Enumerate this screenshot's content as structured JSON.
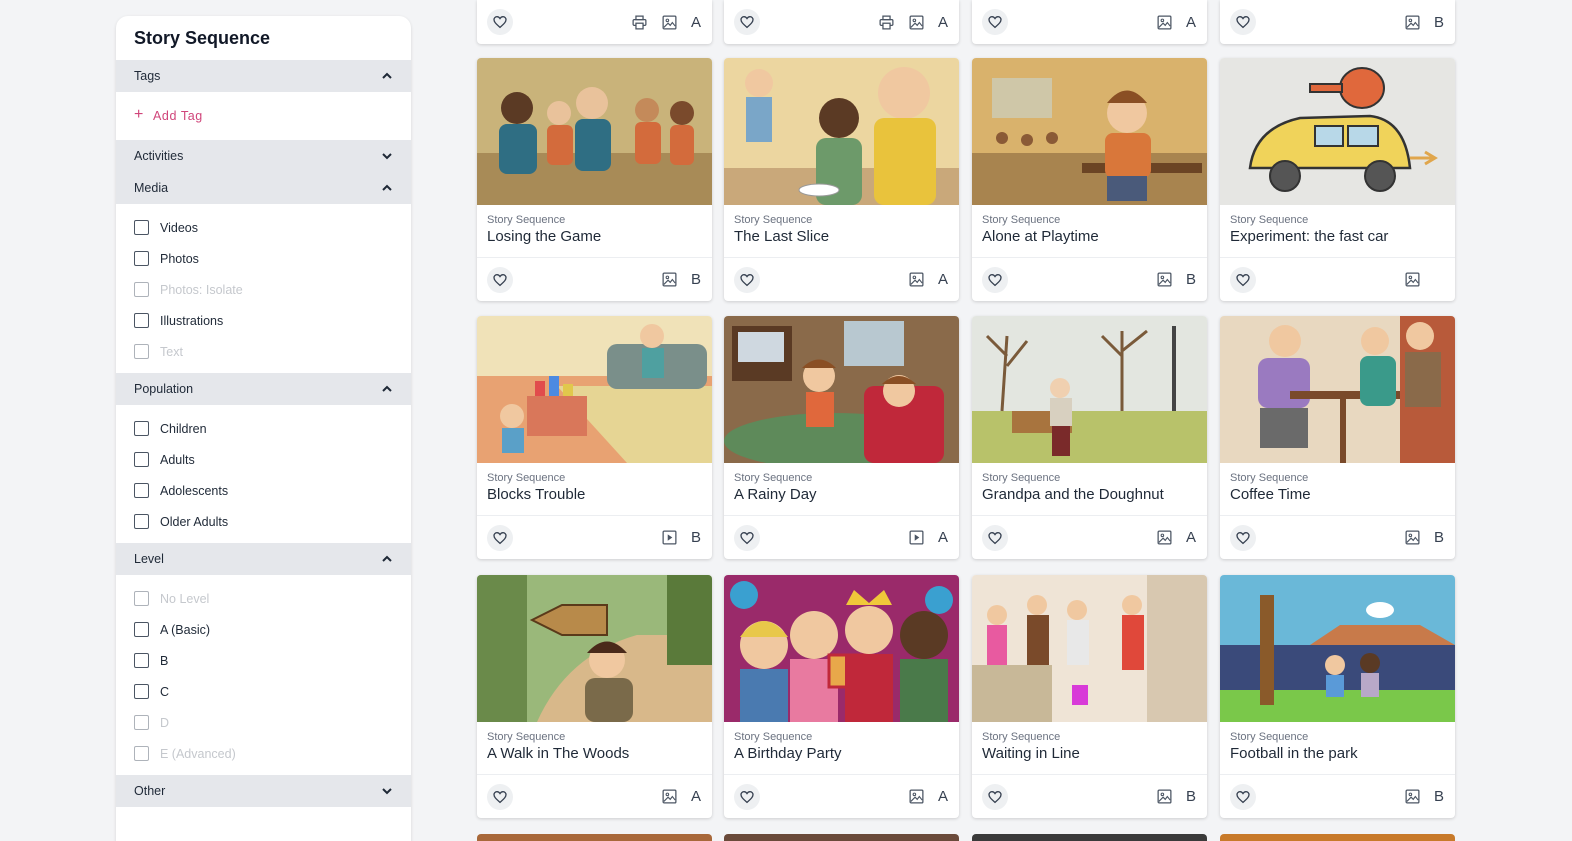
{
  "sidebar": {
    "title": "Story Sequence",
    "tags": {
      "label": "Tags",
      "add_label": "Add Tag"
    },
    "activities": {
      "label": "Activities"
    },
    "media": {
      "label": "Media",
      "options": [
        {
          "label": "Videos",
          "disabled": false
        },
        {
          "label": "Photos",
          "disabled": false
        },
        {
          "label": "Photos: Isolate",
          "disabled": true
        },
        {
          "label": "Illustrations",
          "disabled": false
        },
        {
          "label": "Text",
          "disabled": true
        }
      ]
    },
    "population": {
      "label": "Population",
      "options": [
        {
          "label": "Children",
          "disabled": false
        },
        {
          "label": "Adults",
          "disabled": false
        },
        {
          "label": "Adolescents",
          "disabled": false
        },
        {
          "label": "Older Adults",
          "disabled": false
        }
      ]
    },
    "level": {
      "label": "Level",
      "options": [
        {
          "label": "No Level",
          "disabled": true
        },
        {
          "label": "A (Basic)",
          "disabled": false
        },
        {
          "label": "B",
          "disabled": false
        },
        {
          "label": "C",
          "disabled": false
        },
        {
          "label": "D",
          "disabled": true
        },
        {
          "label": "E (Advanced)",
          "disabled": true
        }
      ]
    },
    "other": {
      "label": "Other"
    }
  },
  "top_row": [
    {
      "icons": [
        "print-icon",
        "image-icon"
      ],
      "level": "A"
    },
    {
      "icons": [
        "print-icon",
        "image-icon"
      ],
      "level": "A"
    },
    {
      "icons": [
        "image-icon"
      ],
      "level": "A"
    },
    {
      "icons": [
        "image-icon"
      ],
      "level": "B"
    }
  ],
  "cards": [
    {
      "category": "Story Sequence",
      "title": "Losing the Game",
      "media_icon": "image-icon",
      "level": "B"
    },
    {
      "category": "Story Sequence",
      "title": "The Last Slice",
      "media_icon": "image-icon",
      "level": "A"
    },
    {
      "category": "Story Sequence",
      "title": "Alone at Playtime",
      "media_icon": "image-icon",
      "level": "B"
    },
    {
      "category": "Story Sequence",
      "title": "Experiment: the fast car",
      "media_icon": "image-icon",
      "level": ""
    },
    {
      "category": "Story Sequence",
      "title": "Blocks Trouble",
      "media_icon": "video-icon",
      "level": "B"
    },
    {
      "category": "Story Sequence",
      "title": "A Rainy Day",
      "media_icon": "video-icon",
      "level": "A"
    },
    {
      "category": "Story Sequence",
      "title": "Grandpa and the Doughnut",
      "media_icon": "image-icon",
      "level": "A"
    },
    {
      "category": "Story Sequence",
      "title": "Coffee Time",
      "media_icon": "image-icon",
      "level": "B"
    },
    {
      "category": "Story Sequence",
      "title": "A Walk in The Woods",
      "media_icon": "image-icon",
      "level": "A"
    },
    {
      "category": "Story Sequence",
      "title": "A Birthday Party",
      "media_icon": "image-icon",
      "level": "A"
    },
    {
      "category": "Story Sequence",
      "title": "Waiting in Line",
      "media_icon": "image-icon",
      "level": "B"
    },
    {
      "category": "Story Sequence",
      "title": "Football in the park",
      "media_icon": "image-icon",
      "level": "B"
    }
  ],
  "colors": {
    "accent": "#d0457a",
    "section_bg": "#e5e7eb",
    "page_bg": "#f3f4f6"
  }
}
